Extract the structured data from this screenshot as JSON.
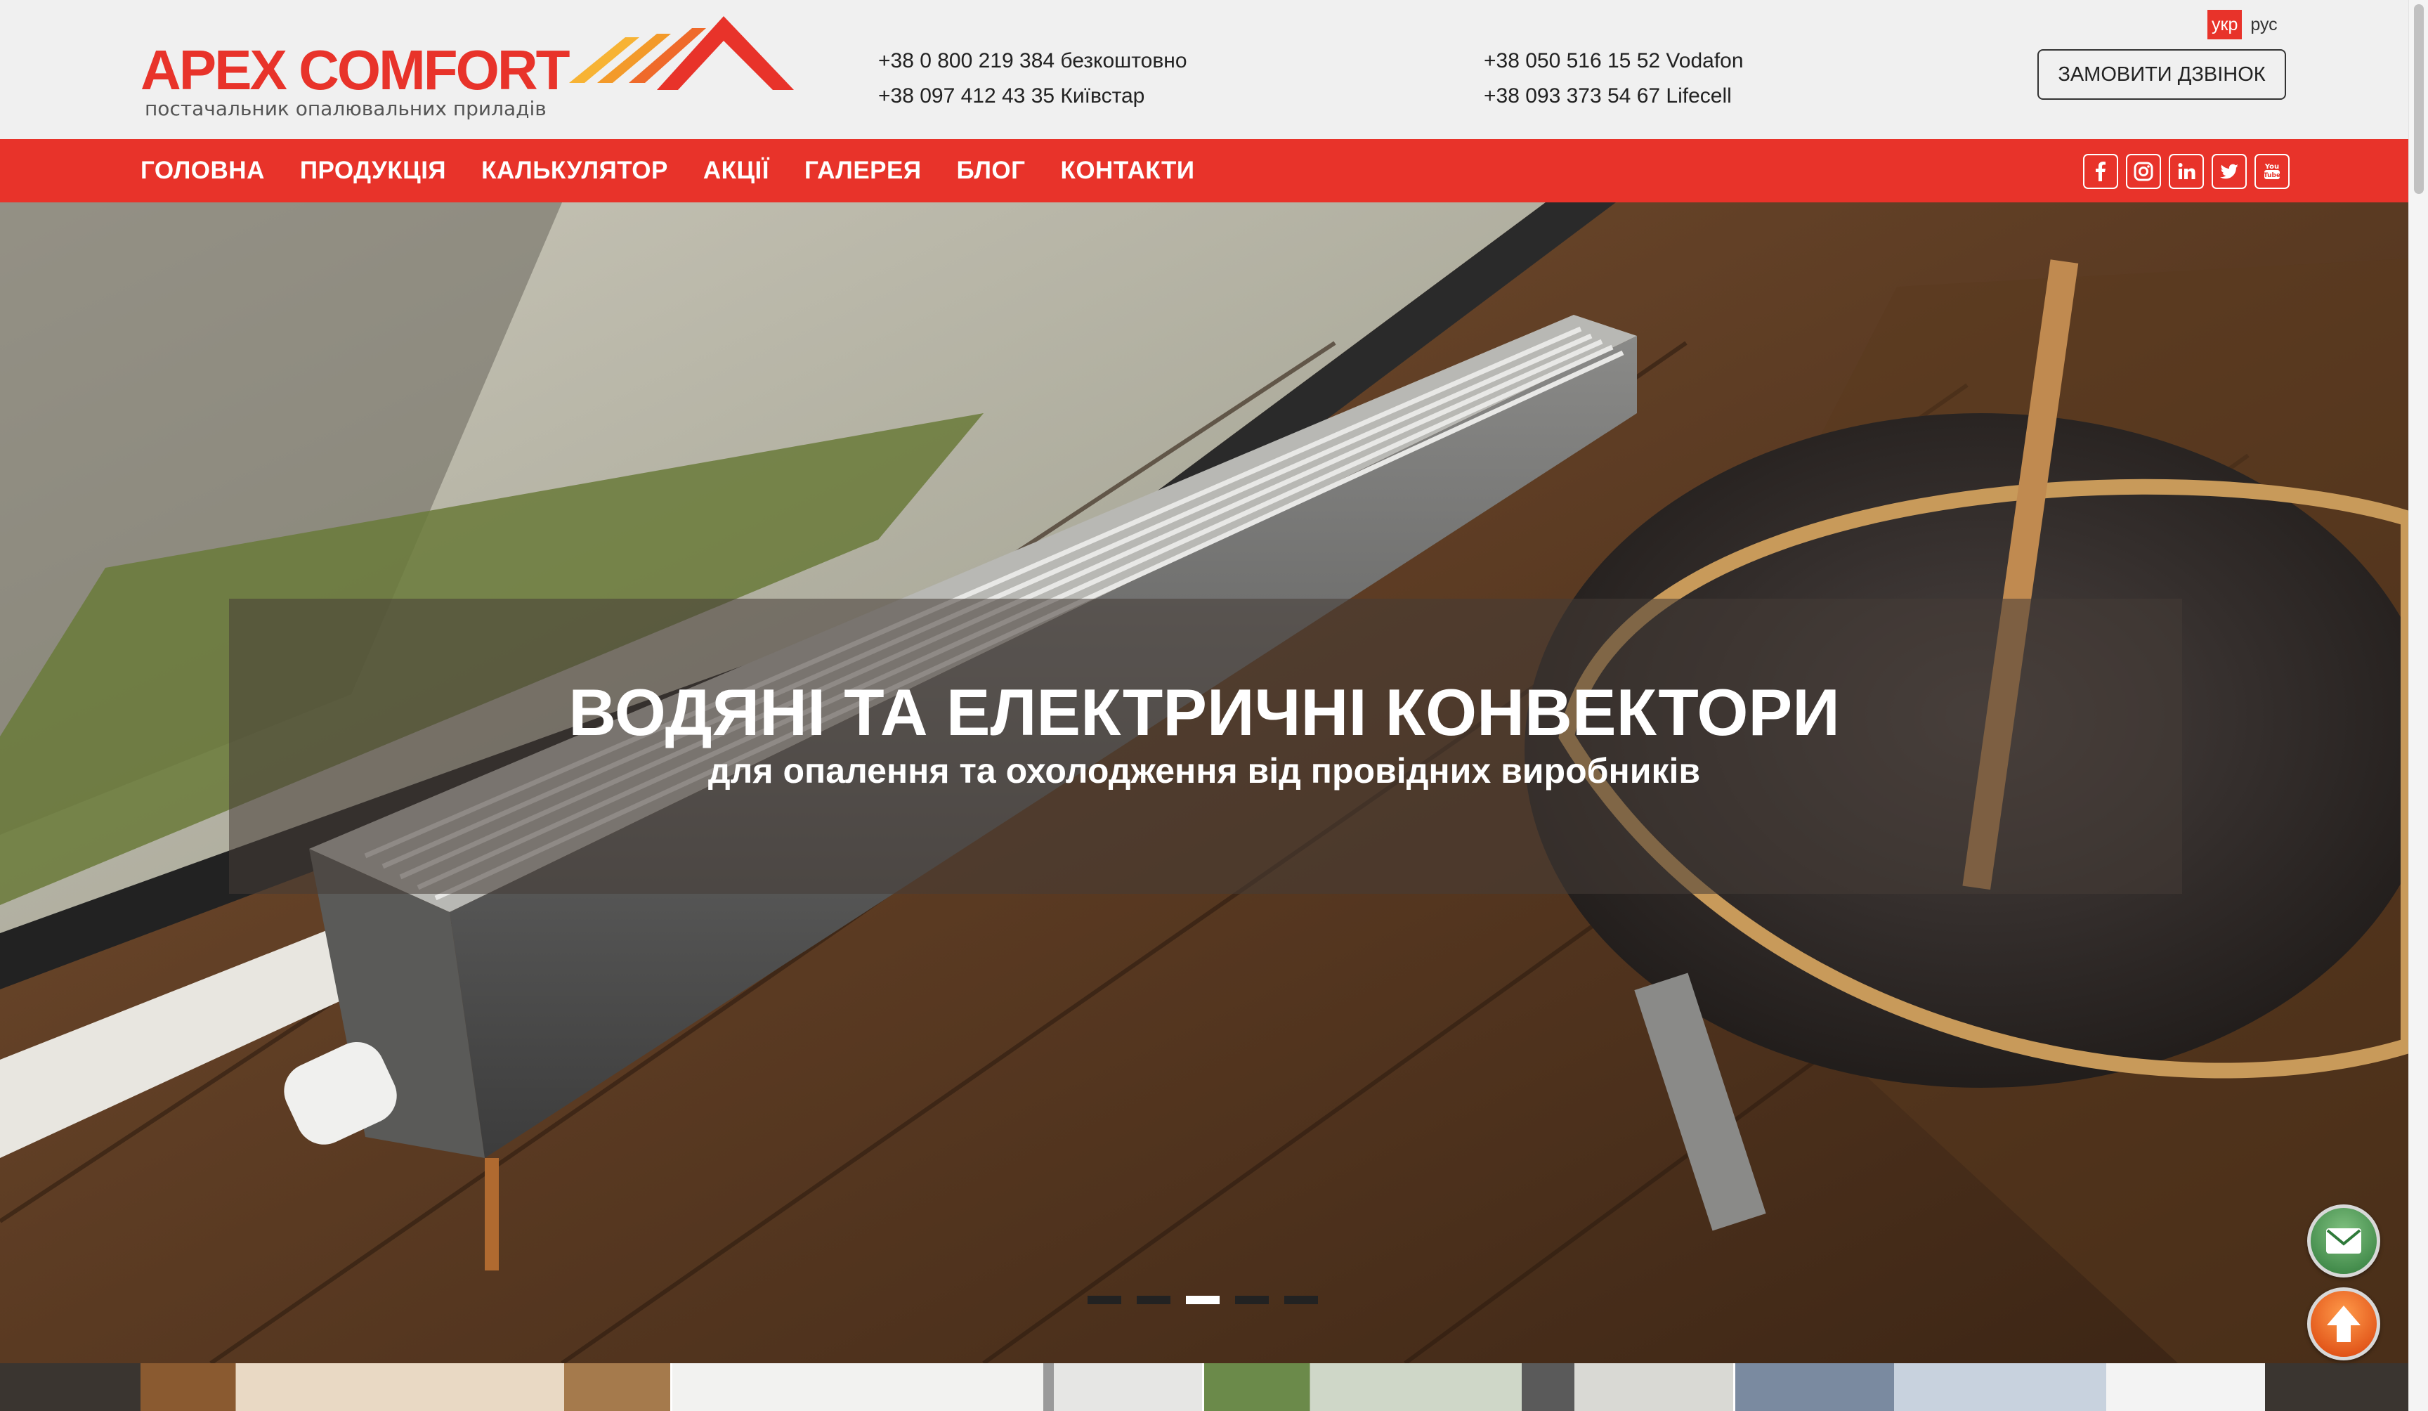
{
  "brand": {
    "name": "APEX COMFORT",
    "tagline": "постачальник опалювальних приладів",
    "color": "#e8332a"
  },
  "contacts": {
    "col1": [
      "+38 0 800 219 384 безкоштовно",
      "+38 097 412 43 35 Київстар"
    ],
    "col2": [
      "+38 050 516 15 52 Vodafon",
      "+38 093 373 54 67 Lifecell"
    ]
  },
  "lang": {
    "active": "укр",
    "other": "рус"
  },
  "callback_button": "ЗАМОВИТИ ДЗВІНОК",
  "nav": [
    "ГОЛОВНА",
    "ПРОДУКЦІЯ",
    "КАЛЬКУЛЯТОР",
    "АКЦІЇ",
    "ГАЛЕРЕЯ",
    "БЛОГ",
    "КОНТАКТИ"
  ],
  "social": [
    "facebook-icon",
    "instagram-icon",
    "linkedin-icon",
    "twitter-icon",
    "youtube-icon"
  ],
  "hero": {
    "title": "ВОДЯНІ ТА ЕЛЕКТРИЧНІ КОНВЕКТОРИ",
    "subtitle": "для опалення та охолодження від провідних виробників",
    "slides_total": 5,
    "slide_active": 3
  },
  "floating": {
    "mail": "mail-icon",
    "up": "arrow-up-icon"
  }
}
